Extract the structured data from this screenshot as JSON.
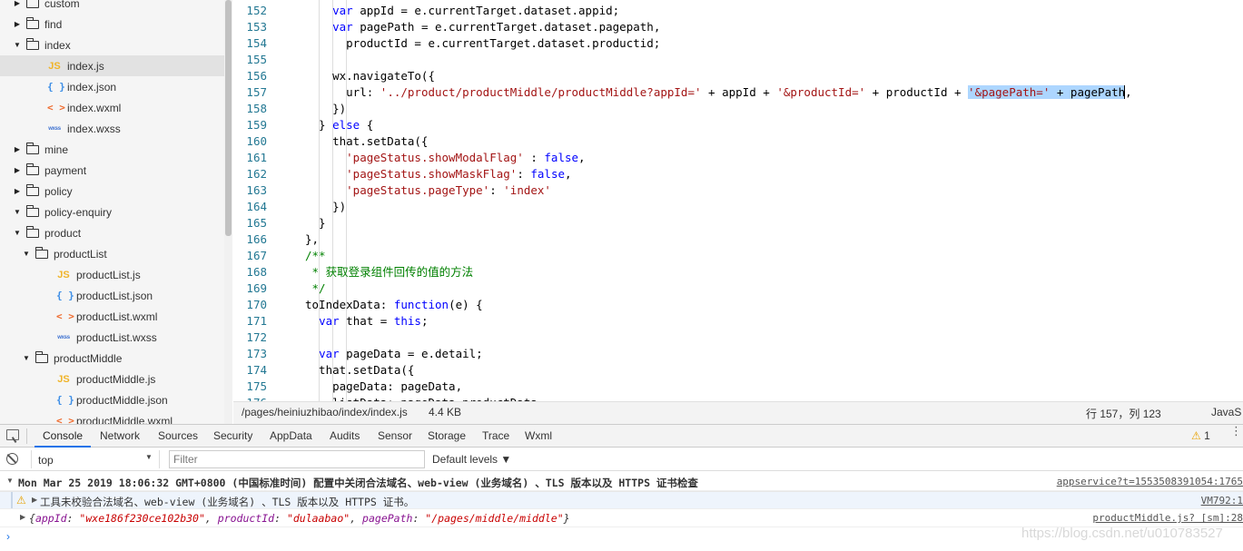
{
  "file_tree": [
    {
      "label": "custom",
      "kind": "folder",
      "expanded": false,
      "depth": 0,
      "icon": "folder-icon"
    },
    {
      "label": "find",
      "kind": "folder",
      "expanded": false,
      "depth": 0,
      "icon": "folder-icon"
    },
    {
      "label": "index",
      "kind": "folder",
      "expanded": true,
      "depth": 0,
      "icon": "folder-open-icon"
    },
    {
      "label": "index.js",
      "kind": "js",
      "depth": 1,
      "selected": true,
      "icon": "js-file-icon",
      "glyph": "JS"
    },
    {
      "label": "index.json",
      "kind": "json",
      "depth": 1,
      "icon": "json-file-icon",
      "glyph": "{ }"
    },
    {
      "label": "index.wxml",
      "kind": "wxml",
      "depth": 1,
      "icon": "wxml-file-icon",
      "glyph": "< >"
    },
    {
      "label": "index.wxss",
      "kind": "wxss",
      "depth": 1,
      "icon": "wxss-file-icon",
      "glyph": "wxss"
    },
    {
      "label": "mine",
      "kind": "folder",
      "expanded": false,
      "depth": 0,
      "icon": "folder-icon"
    },
    {
      "label": "payment",
      "kind": "folder",
      "expanded": false,
      "depth": 0,
      "icon": "folder-icon"
    },
    {
      "label": "policy",
      "kind": "folder",
      "expanded": false,
      "depth": 0,
      "icon": "folder-icon"
    },
    {
      "label": "policy-enquiry",
      "kind": "folder",
      "expanded": true,
      "depth": 0,
      "icon": "folder-open-icon"
    },
    {
      "label": "product",
      "kind": "folder",
      "expanded": true,
      "depth": 0,
      "icon": "folder-open-icon"
    },
    {
      "label": "productList",
      "kind": "folder",
      "expanded": true,
      "depth": 1,
      "icon": "folder-open-icon"
    },
    {
      "label": "productList.js",
      "kind": "js",
      "depth": 2,
      "icon": "js-file-icon",
      "glyph": "JS"
    },
    {
      "label": "productList.json",
      "kind": "json",
      "depth": 2,
      "icon": "json-file-icon",
      "glyph": "{ }"
    },
    {
      "label": "productList.wxml",
      "kind": "wxml",
      "depth": 2,
      "icon": "wxml-file-icon",
      "glyph": "< >"
    },
    {
      "label": "productList.wxss",
      "kind": "wxss",
      "depth": 2,
      "icon": "wxss-file-icon",
      "glyph": "wxss"
    },
    {
      "label": "productMiddle",
      "kind": "folder",
      "expanded": true,
      "depth": 1,
      "icon": "folder-open-icon"
    },
    {
      "label": "productMiddle.js",
      "kind": "js",
      "depth": 2,
      "icon": "js-file-icon",
      "glyph": "JS"
    },
    {
      "label": "productMiddle.json",
      "kind": "json",
      "depth": 2,
      "icon": "json-file-icon",
      "glyph": "{ }"
    },
    {
      "label": "productMiddle.wxml",
      "kind": "wxml",
      "depth": 2,
      "icon": "wxml-file-icon",
      "glyph": "< >"
    }
  ],
  "editor": {
    "lines": [
      {
        "num": "152",
        "tokens": [
          [
            "    ",
            ""
          ],
          [
            "var",
            "kw"
          ],
          [
            " appId = e.currentTarget.dataset.appid;",
            ""
          ]
        ]
      },
      {
        "num": "153",
        "tokens": [
          [
            "    ",
            ""
          ],
          [
            "var",
            "kw"
          ],
          [
            " pagePath = e.currentTarget.dataset.pagepath,",
            ""
          ]
        ]
      },
      {
        "num": "154",
        "tokens": [
          [
            "      productId = e.currentTarget.dataset.productid;",
            ""
          ]
        ]
      },
      {
        "num": "155",
        "tokens": []
      },
      {
        "num": "156",
        "tokens": [
          [
            "    wx.navigateTo({",
            ""
          ]
        ]
      },
      {
        "num": "157",
        "tokens": [
          [
            "      url: ",
            ""
          ],
          [
            "'../product/productMiddle/productMiddle?appId='",
            "str"
          ],
          [
            " + appId + ",
            ""
          ],
          [
            "'&productId='",
            "str"
          ],
          [
            " + productId + ",
            ""
          ],
          [
            "'&pagePath='",
            "str hl"
          ],
          [
            " + pagePath",
            "hl"
          ],
          [
            ",",
            "caret"
          ]
        ]
      },
      {
        "num": "158",
        "tokens": [
          [
            "    })",
            ""
          ]
        ]
      },
      {
        "num": "159",
        "tokens": [
          [
            "  } ",
            ""
          ],
          [
            "else",
            "kw"
          ],
          [
            " {",
            ""
          ]
        ]
      },
      {
        "num": "160",
        "tokens": [
          [
            "    that.setData({",
            ""
          ]
        ]
      },
      {
        "num": "161",
        "tokens": [
          [
            "      ",
            ""
          ],
          [
            "'pageStatus.showModalFlag'",
            "str"
          ],
          [
            " : ",
            ""
          ],
          [
            "false",
            "kw"
          ],
          [
            ",",
            ""
          ]
        ]
      },
      {
        "num": "162",
        "tokens": [
          [
            "      ",
            ""
          ],
          [
            "'pageStatus.showMaskFlag'",
            "str"
          ],
          [
            ": ",
            ""
          ],
          [
            "false",
            "kw"
          ],
          [
            ",",
            ""
          ]
        ]
      },
      {
        "num": "163",
        "tokens": [
          [
            "      ",
            ""
          ],
          [
            "'pageStatus.pageType'",
            "str"
          ],
          [
            ": ",
            ""
          ],
          [
            "'index'",
            "str"
          ]
        ]
      },
      {
        "num": "164",
        "tokens": [
          [
            "    })",
            ""
          ]
        ]
      },
      {
        "num": "165",
        "tokens": [
          [
            "  }",
            ""
          ]
        ]
      },
      {
        "num": "166",
        "tokens": [
          [
            "},",
            ""
          ]
        ]
      },
      {
        "num": "167",
        "tokens": [
          [
            "/**",
            "com"
          ]
        ]
      },
      {
        "num": "168",
        "tokens": [
          [
            " * 获取登录组件回传的值的方法",
            "com"
          ]
        ]
      },
      {
        "num": "169",
        "tokens": [
          [
            " */",
            "com"
          ]
        ]
      },
      {
        "num": "170",
        "tokens": [
          [
            "toIndexData: ",
            ""
          ],
          [
            "function",
            "kw"
          ],
          [
            "(e) {",
            ""
          ]
        ]
      },
      {
        "num": "171",
        "tokens": [
          [
            "  ",
            ""
          ],
          [
            "var",
            "kw"
          ],
          [
            " that = ",
            ""
          ],
          [
            "this",
            "kw"
          ],
          [
            ";",
            ""
          ]
        ]
      },
      {
        "num": "172",
        "tokens": []
      },
      {
        "num": "173",
        "tokens": [
          [
            "  ",
            ""
          ],
          [
            "var",
            "kw"
          ],
          [
            " pageData = e.detail;",
            ""
          ]
        ]
      },
      {
        "num": "174",
        "tokens": [
          [
            "  that.setData({",
            ""
          ]
        ]
      },
      {
        "num": "175",
        "tokens": [
          [
            "    pageData: pageData,",
            ""
          ]
        ]
      },
      {
        "num": "176",
        "tokens": [
          [
            "    listData: pageData.productData",
            ""
          ]
        ]
      }
    ]
  },
  "statusbar": {
    "path": "/pages/heiniuzhibao/index/index.js",
    "size": "4.4 KB",
    "cursor": "行 157，列 123",
    "language": "JavaS"
  },
  "devtools": {
    "tabs": [
      "Console",
      "Network",
      "Sources",
      "Security",
      "AppData",
      "Audits",
      "Sensor",
      "Storage",
      "Trace",
      "Wxml"
    ],
    "active_tab": "Console",
    "warning_count": "1"
  },
  "console_toolbar": {
    "context": "top",
    "filter_placeholder": "Filter",
    "levels": "Default levels ▼"
  },
  "console_messages": {
    "group": {
      "text": "Mon Mar 25 2019 18:06:32 GMT+0800 (中国标准时间) 配置中关闭合法域名、web-view (业务域名) 、TLS 版本以及 HTTPS 证书检查",
      "source": "appservice?t=1553508391054:1765"
    },
    "warning": {
      "text": "工具未校验合法域名、web-view (业务域名) 、TLS 版本以及 HTTPS 证书。",
      "source": "VM792:1"
    },
    "object": {
      "open": "{",
      "k1": "appId",
      "v1": "\"wxe186f230ce102b30\"",
      "k2": "productId",
      "v2": "\"dulaabao\"",
      "k3": "pagePath",
      "v3": "\"/pages/middle/middle\"",
      "close": "}",
      "source": "productMiddle.js? [sm]:28"
    }
  },
  "watermark": "https://blog.csdn.net/u010783527",
  "colors": {
    "accent": "#1a73e8",
    "keyword": "#0000ff",
    "string": "#a31515",
    "comment": "#008000",
    "line_number": "#237893",
    "selection": "#add6ff",
    "warning": "#e8a100"
  }
}
